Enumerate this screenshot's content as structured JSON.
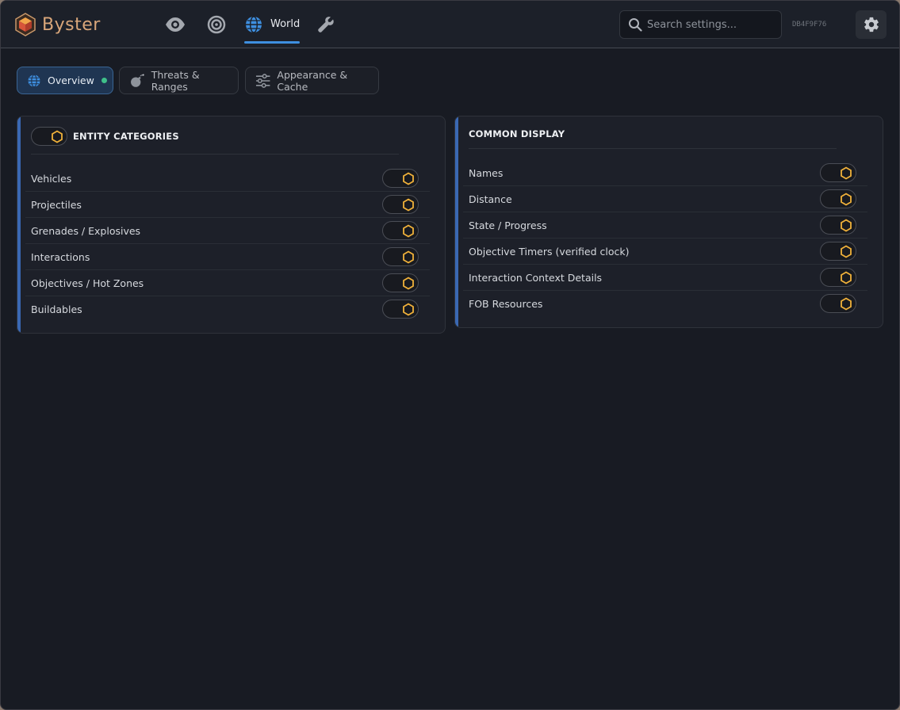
{
  "app": {
    "name": "Byster",
    "build_hash": "DB4F9F76"
  },
  "nav": {
    "items": [
      {
        "icon": "eye-icon"
      },
      {
        "icon": "target-icon"
      },
      {
        "icon": "globe-icon",
        "label": "World",
        "active": true
      },
      {
        "icon": "wrench-icon"
      }
    ]
  },
  "search": {
    "placeholder": "Search settings..."
  },
  "tabs": [
    {
      "label": "Overview",
      "icon": "globe-icon",
      "active": true,
      "status": "green-dot"
    },
    {
      "label": "Threats & Ranges",
      "icon": "bomb-icon"
    },
    {
      "label": "Appearance & Cache",
      "icon": "sliders-icon"
    }
  ],
  "panels": {
    "entity_categories": {
      "title": "ENTITY CATEGORIES",
      "master_toggle": true,
      "items": [
        {
          "label": "Vehicles",
          "enabled": true
        },
        {
          "label": "Projectiles",
          "enabled": true
        },
        {
          "label": "Grenades / Explosives",
          "enabled": true
        },
        {
          "label": "Interactions",
          "enabled": true
        },
        {
          "label": "Objectives / Hot Zones",
          "enabled": true
        },
        {
          "label": "Buildables",
          "enabled": true
        }
      ]
    },
    "common_display": {
      "title": "COMMON DISPLAY",
      "items": [
        {
          "label": "Names",
          "enabled": true
        },
        {
          "label": "Distance",
          "enabled": true
        },
        {
          "label": "State / Progress",
          "enabled": true
        },
        {
          "label": "Objective Timers (verified clock)",
          "enabled": true
        },
        {
          "label": "Interaction Context Details",
          "enabled": true
        },
        {
          "label": "FOB Resources",
          "enabled": true
        }
      ]
    }
  },
  "colors": {
    "accent_blue": "#3e8fe0",
    "toggle_knob": "#f0b13a",
    "status_green": "#3fc08a",
    "brand": "#d9a67a"
  }
}
